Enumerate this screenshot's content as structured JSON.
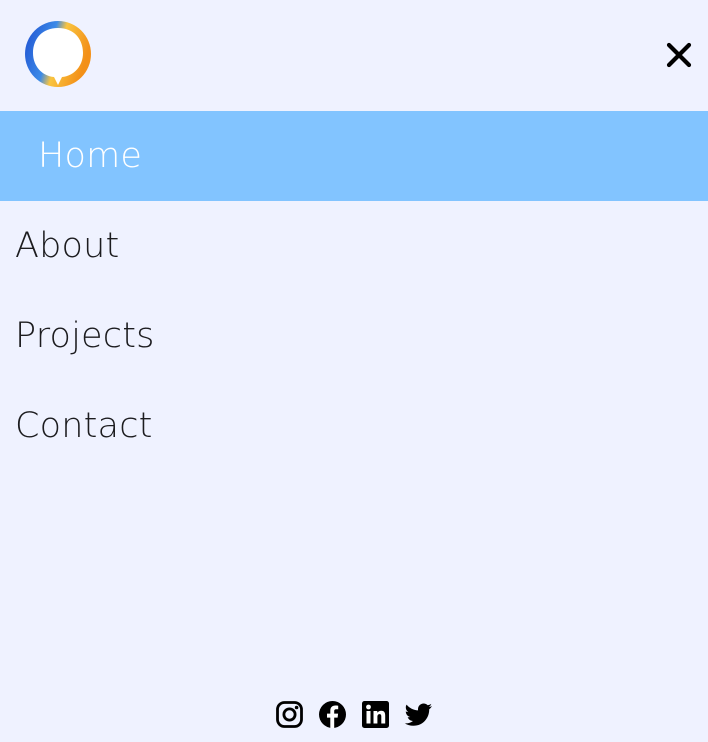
{
  "colors": {
    "background": "#eff2ff",
    "active_item_background": "#82c4ff",
    "active_item_text": "#ffffff",
    "item_text": "#1c1c1f",
    "icon": "#000000",
    "logo_blue": "#1d5fd6",
    "logo_orange": "#f7a31c"
  },
  "header": {
    "logo_icon": "speech-bubble-logo-icon",
    "close_icon": "close-x-icon"
  },
  "nav": {
    "items": [
      {
        "label": "Home",
        "active": true
      },
      {
        "label": "About",
        "active": false
      },
      {
        "label": "Projects",
        "active": false
      },
      {
        "label": "Contact",
        "active": false
      }
    ]
  },
  "social": {
    "icons": [
      "instagram-icon",
      "facebook-icon",
      "linkedin-icon",
      "twitter-icon"
    ]
  }
}
